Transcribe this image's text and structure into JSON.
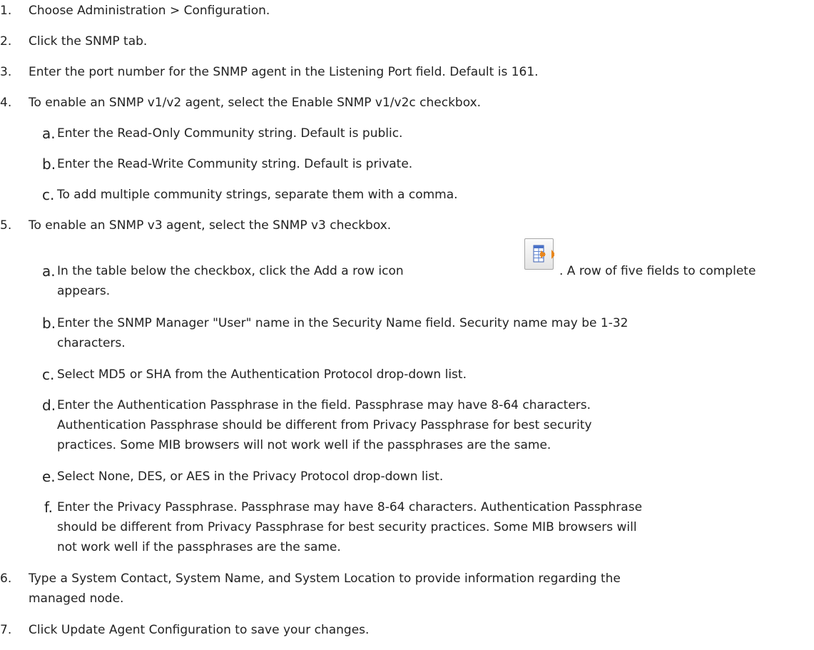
{
  "steps": [
    {
      "num": "1.",
      "text": "Choose Administration > Configuration."
    },
    {
      "num": "2.",
      "text": "Click the SNMP tab."
    },
    {
      "num": "3.",
      "text": "Enter the port number for the SNMP agent in the Listening Port field. Default is 161."
    },
    {
      "num": "4.",
      "text": "To enable an SNMP v1/v2 agent, select the Enable SNMP v1/v2c checkbox."
    },
    {
      "num": "5.",
      "text": "To enable an SNMP v3 agent, select the SNMP v3 checkbox."
    },
    {
      "num": "6.",
      "text_lines": [
        "Type a System Contact, System Name, and System Location to provide information regarding the",
        "managed node."
      ]
    },
    {
      "num": "7.",
      "text": "Click Update Agent Configuration to save your changes."
    }
  ],
  "substeps4": [
    {
      "letter": "a.",
      "text": "Enter the Read-Only Community string. Default is public."
    },
    {
      "letter": "b.",
      "text": "Enter the Read-Write Community string. Default is private."
    },
    {
      "letter": "c.",
      "text": "To add multiple community strings, separate them with a comma."
    }
  ],
  "substeps5": [
    {
      "letter": "a.",
      "text_before_icon": "In the table below the checkbox, click the Add a row icon",
      "text_after_icon": ". A row of five fields to complete",
      "continuation": "appears."
    },
    {
      "letter": "b.",
      "lines": [
        "Enter the SNMP Manager \"User\" name in the Security Name field. Security name may be 1-32",
        "characters."
      ]
    },
    {
      "letter": "c.",
      "lines": [
        "Select MD5 or SHA from the Authentication Protocol drop-down list."
      ]
    },
    {
      "letter": "d.",
      "lines": [
        "Enter the Authentication Passphrase in the field. Passphrase may have 8-64 characters.",
        "Authentication Passphrase should be different from Privacy Passphrase for best security",
        "practices. Some MIB browsers will not work well if the passphrases are the same."
      ]
    },
    {
      "letter": "e.",
      "lines": [
        "Select None, DES, or AES in the Privacy Protocol drop-down list."
      ]
    },
    {
      "letter": "f.",
      "lines": [
        "Enter the Privacy Passphrase. Passphrase may have 8-64 characters. Authentication Passphrase",
        "should be different from Privacy Passphrase for best security practices. Some MIB browsers will",
        "not work well if the passphrases are the same."
      ]
    }
  ],
  "icons": {
    "add_row": "add-row-table-icon"
  },
  "colors": {
    "text": "#222222",
    "icon_blue": "#4a72c8",
    "icon_orange": "#e8871e"
  }
}
